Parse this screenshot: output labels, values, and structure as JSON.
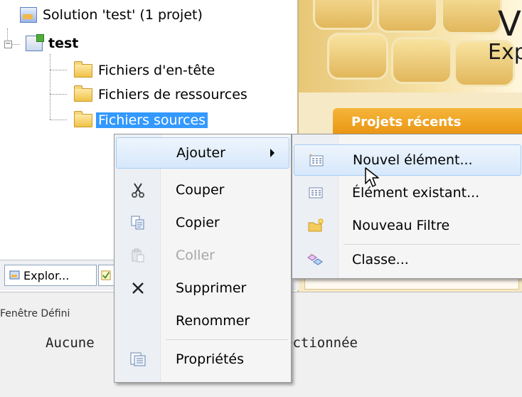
{
  "solution_tree": {
    "solution_label": "Solution 'test' (1 projet)",
    "project_label": "test",
    "folders": [
      "Fichiers d'en-tête",
      "Fichiers de ressources",
      "Fichiers sources"
    ],
    "selected_folder": "Fichiers sources"
  },
  "start_page": {
    "title_fragment": "Vi",
    "subtitle_fragment": "Exp",
    "recent_projects_label": "Projets récents",
    "accent_color": "#e99310"
  },
  "tabs": {
    "explorer_label": "Explor..."
  },
  "definition_window": {
    "title": "Fenêtre Défini",
    "text_left": "Aucune",
    "text_right": "ectionnée"
  },
  "context_menu": {
    "items": [
      {
        "label": "Ajouter",
        "icon": "none",
        "submenu": true,
        "highlighted": true
      },
      {
        "label": "Couper",
        "icon": "scissors-icon"
      },
      {
        "label": "Copier",
        "icon": "copy-icon"
      },
      {
        "label": "Coller",
        "icon": "paste-icon",
        "disabled": true
      },
      {
        "label": "Supprimer",
        "icon": "delete-x-icon"
      },
      {
        "label": "Renommer",
        "icon": "none"
      },
      {
        "label": "Propriétés",
        "icon": "properties-icon"
      }
    ]
  },
  "add_submenu": {
    "items": [
      {
        "label": "Nouvel élément...",
        "icon": "new-item-icon",
        "highlighted": true
      },
      {
        "label": "Élément existant...",
        "icon": "existing-item-icon"
      },
      {
        "label": "Nouveau Filtre",
        "icon": "new-filter-icon"
      },
      {
        "label": "Classe...",
        "icon": "class-icon"
      }
    ]
  },
  "colors": {
    "menu_highlight_border": "#a8cdf3",
    "selection_blue": "#3399ff"
  }
}
